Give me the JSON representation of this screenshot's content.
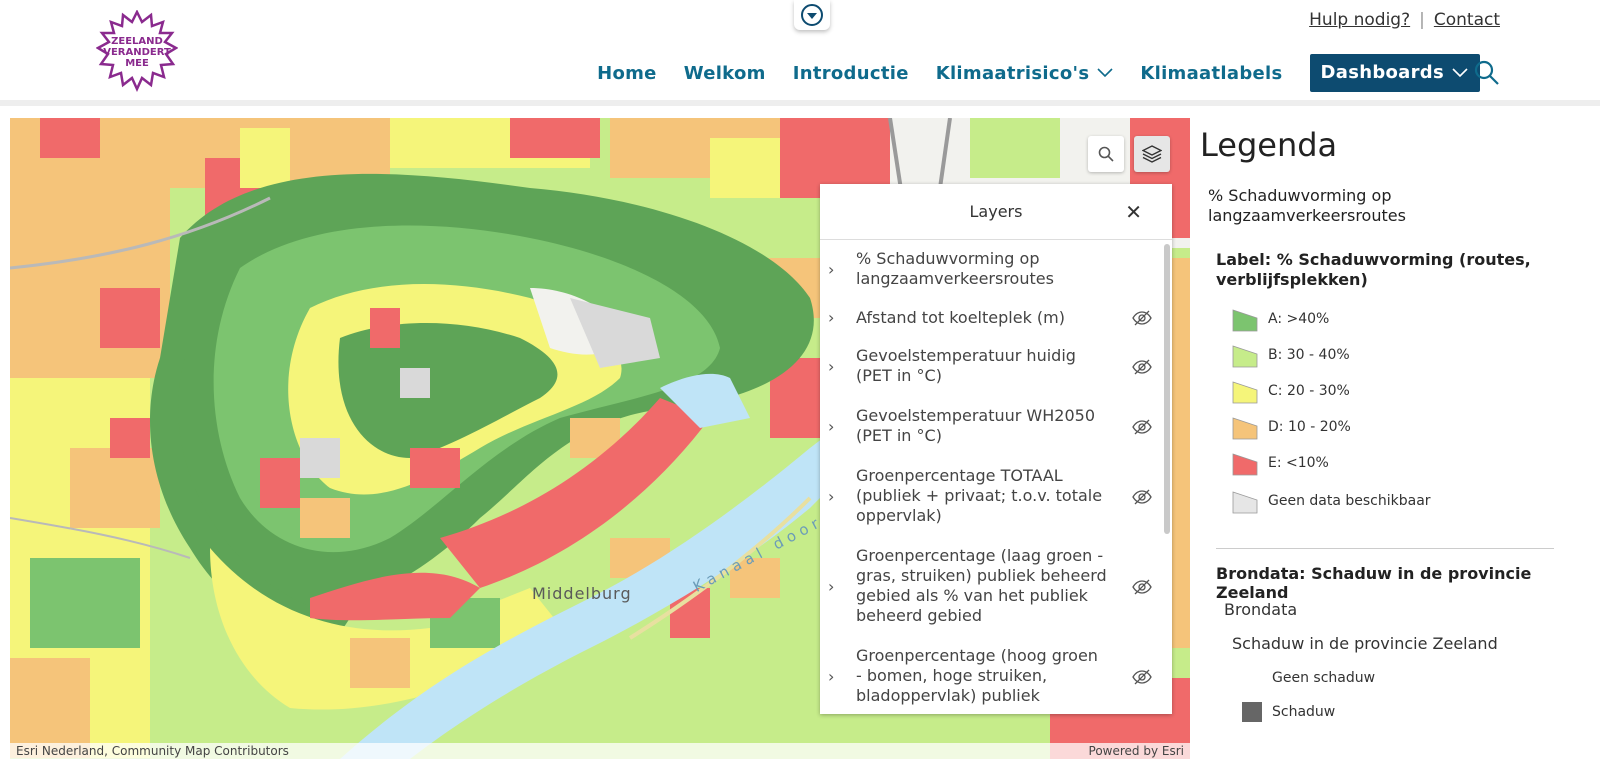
{
  "header": {
    "logo_text": [
      "ZEELAND",
      "VERANDERT",
      "MEE"
    ],
    "utility_links": [
      "Hulp nodig?",
      "Contact"
    ],
    "nav": [
      {
        "label": "Home"
      },
      {
        "label": "Welkom"
      },
      {
        "label": "Introductie"
      },
      {
        "label": "Klimaatrisico's"
      },
      {
        "label": "Klimaatlabels"
      },
      {
        "label": "Dashboards"
      }
    ]
  },
  "map": {
    "labels": {
      "city": "Middelburg",
      "canal": "Kanaal door"
    },
    "attribution": "Esri Nederland, Community Map Contributors",
    "powered_by": "Powered by Esri"
  },
  "layers_panel": {
    "title": "Layers",
    "items": [
      {
        "label": "% Schaduwvorming op langzaamverkeersroutes",
        "visible": true
      },
      {
        "label": "Afstand tot koelteplek (m)",
        "visible": false
      },
      {
        "label": "Gevoelstemperatuur huidig (PET in °C)",
        "visible": false
      },
      {
        "label": "Gevoelstemperatuur WH2050 (PET in °C)",
        "visible": false
      },
      {
        "label": "Groenpercentage TOTAAL (publiek + privaat; t.o.v. totale oppervlak)",
        "visible": false
      },
      {
        "label": "Groenpercentage (laag groen - gras, struiken) publiek beheerd gebied als % van het publiek beheerd gebied",
        "visible": false
      },
      {
        "label": "Groenpercentage (hoog groen - bomen, hoge struiken, bladoppervlak) publiek",
        "visible": false
      }
    ]
  },
  "legend": {
    "title": "Legenda",
    "layer_title": "% Schaduwvorming op langzaamverkeersroutes",
    "field_title": "Label: % Schaduwvorming (routes, verblijfsplekken)",
    "classes": [
      {
        "label": "A: >40%",
        "color": "#7cc46f"
      },
      {
        "label": "B: 30 - 40%",
        "color": "#c6ec8a"
      },
      {
        "label": "C: 20 - 30%",
        "color": "#f5f57a"
      },
      {
        "label": "D: 10 - 20%",
        "color": "#f5c47a"
      },
      {
        "label": "E: <10%",
        "color": "#f06a6a"
      },
      {
        "label": "Geen data beschikbaar",
        "color": "#e6e6e6"
      }
    ],
    "source_title": "Brondata: Schaduw in de provincie Zeeland",
    "source_sub1": "Brondata",
    "source_sub2": "Schaduw in de provincie Zeeland",
    "source_items": [
      "Geen schaduw",
      "Schaduw"
    ]
  }
}
